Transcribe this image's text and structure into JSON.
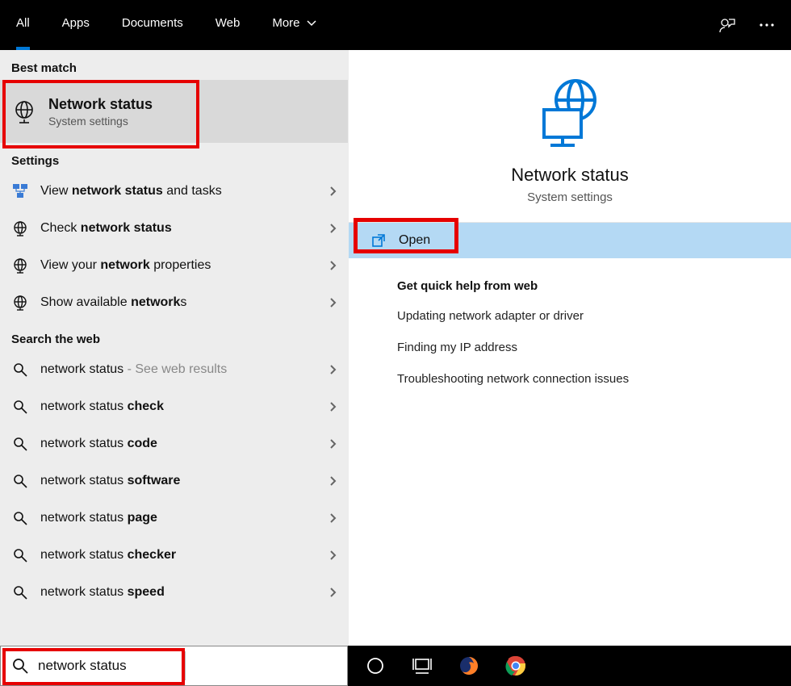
{
  "tabs": {
    "all": "All",
    "apps": "Apps",
    "documents": "Documents",
    "web": "Web",
    "more": "More"
  },
  "left": {
    "best_match_header": "Best match",
    "best_title": "Network status",
    "best_sub": "System settings",
    "settings_header": "Settings",
    "settings_items": [
      {
        "prefix": "View ",
        "bold": "network status",
        "suffix": " and tasks"
      },
      {
        "prefix": "Check ",
        "bold": "network status",
        "suffix": ""
      },
      {
        "prefix": "View your ",
        "bold": "network",
        "suffix": " properties"
      },
      {
        "prefix": "Show available ",
        "bold": "network",
        "suffix": "s"
      }
    ],
    "search_web_header": "Search the web",
    "web_items": [
      {
        "base": "network status",
        "extra": "",
        "hint": " - See web results"
      },
      {
        "base": "network status ",
        "extra": "check",
        "hint": ""
      },
      {
        "base": "network status ",
        "extra": "code",
        "hint": ""
      },
      {
        "base": "network status ",
        "extra": "software",
        "hint": ""
      },
      {
        "base": "network status ",
        "extra": "page",
        "hint": ""
      },
      {
        "base": "network status ",
        "extra": "checker",
        "hint": ""
      },
      {
        "base": "network status ",
        "extra": "speed",
        "hint": ""
      }
    ]
  },
  "right": {
    "title": "Network status",
    "sub": "System settings",
    "open_label": "Open",
    "help_title": "Get quick help from web",
    "help_items": [
      "Updating network adapter or driver",
      "Finding my IP address",
      "Troubleshooting network connection issues"
    ]
  },
  "search": {
    "value": "network status"
  }
}
